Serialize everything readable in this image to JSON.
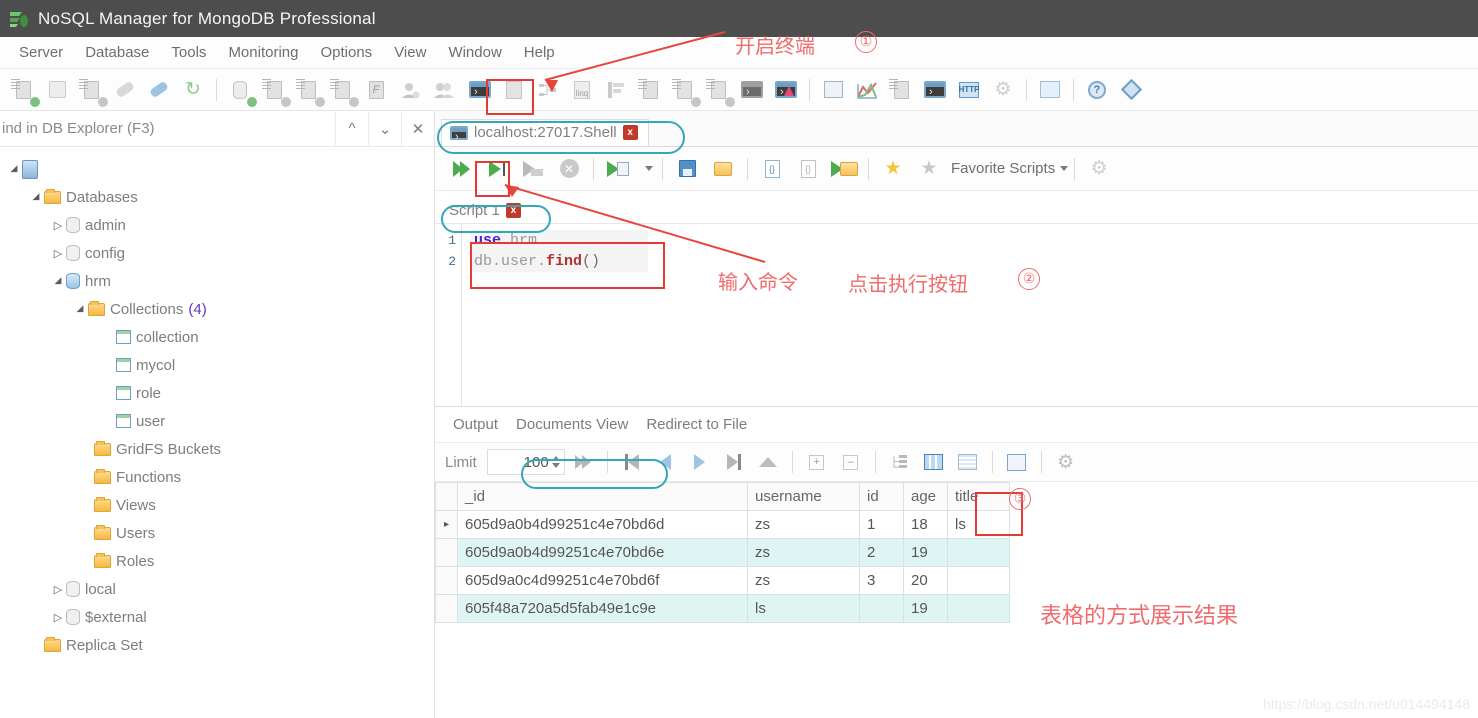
{
  "window": {
    "title": "NoSQL Manager for MongoDB Professional",
    "app_icon": "mongodb-leaf-icon"
  },
  "menubar": {
    "items": [
      "Server",
      "Database",
      "Tools",
      "Monitoring",
      "Options",
      "View",
      "Window",
      "Help"
    ]
  },
  "toolbar": {
    "buttons": [
      {
        "name": "new-connection-icon",
        "label": "New Connection"
      },
      {
        "name": "edit-connection-icon",
        "label": "Edit Connection"
      },
      {
        "name": "duplicate-connection-icon",
        "label": "Duplicate Connection"
      },
      {
        "name": "connect-icon",
        "label": "Connect"
      },
      {
        "name": "disconnect-icon",
        "label": "Disconnect"
      },
      {
        "name": "refresh-icon",
        "label": "Refresh"
      },
      {
        "name": "new-database-icon",
        "label": "New Database"
      },
      {
        "name": "new-collection-icon",
        "label": "New Collection"
      },
      {
        "name": "new-view-icon",
        "label": "New View"
      },
      {
        "name": "new-document-icon",
        "label": "New Document"
      },
      {
        "name": "new-function-icon",
        "label": "New Function"
      },
      {
        "name": "new-user-icon",
        "label": "New User"
      },
      {
        "name": "new-role-icon",
        "label": "New Role"
      },
      {
        "name": "open-shell-icon",
        "label": "Open Shell"
      },
      {
        "name": "open-document-editor-icon",
        "label": "Document Editor"
      },
      {
        "name": "aggregation-builder-icon",
        "label": "Aggregation Builder"
      },
      {
        "name": "linq-query-icon",
        "label": "LINQ Query"
      },
      {
        "name": "sql-query-icon",
        "label": "SQL Query"
      },
      {
        "name": "table-view-icon",
        "label": "Table View"
      },
      {
        "name": "import-icon",
        "label": "Import"
      },
      {
        "name": "export-icon",
        "label": "Export"
      },
      {
        "name": "backup-icon",
        "label": "Backup"
      },
      {
        "name": "restore-icon",
        "label": "Restore"
      },
      {
        "name": "options-window-icon",
        "label": "Options"
      },
      {
        "name": "chart-icon",
        "label": "Charts"
      },
      {
        "name": "copy-documents-icon",
        "label": "Copy Documents"
      },
      {
        "name": "shell-window-icon",
        "label": "Shell Window"
      },
      {
        "name": "http-icon",
        "label": "HTTP Interface"
      },
      {
        "name": "settings-gear-icon",
        "label": "Settings"
      },
      {
        "name": "home-icon",
        "label": "Home"
      },
      {
        "name": "help-icon",
        "label": "Help"
      },
      {
        "name": "about-icon",
        "label": "About"
      }
    ]
  },
  "explorer": {
    "find_label": "ind in DB Explorer (F3)",
    "find_prev_icon": "chevron-up-icon",
    "find_next_icon": "chevron-down-icon",
    "find_close_icon": "close-icon",
    "tree": [
      {
        "label": "",
        "icon": "server-icon",
        "depth": 0,
        "twisty": "open"
      },
      {
        "label": "Databases",
        "icon": "folder-icon",
        "depth": 1,
        "twisty": "open"
      },
      {
        "label": "admin",
        "icon": "database-icon",
        "depth": 2,
        "twisty": "closed"
      },
      {
        "label": "config",
        "icon": "database-icon",
        "depth": 2,
        "twisty": "closed"
      },
      {
        "label": "hrm",
        "icon": "database-active-icon",
        "depth": 2,
        "twisty": "open"
      },
      {
        "label": "Collections",
        "count": "(4)",
        "icon": "folder-icon",
        "depth": 3,
        "twisty": "open"
      },
      {
        "label": "collection",
        "icon": "collection-icon",
        "depth": 4,
        "twisty": "none"
      },
      {
        "label": "mycol",
        "icon": "collection-icon",
        "depth": 4,
        "twisty": "none"
      },
      {
        "label": "role",
        "icon": "collection-icon",
        "depth": 4,
        "twisty": "none"
      },
      {
        "label": "user",
        "icon": "collection-icon",
        "depth": 4,
        "twisty": "none"
      },
      {
        "label": "GridFS Buckets",
        "icon": "folder-icon",
        "depth": 3,
        "twisty": "none"
      },
      {
        "label": "Functions",
        "icon": "folder-icon",
        "depth": 3,
        "twisty": "none"
      },
      {
        "label": "Views",
        "icon": "folder-icon",
        "depth": 3,
        "twisty": "none"
      },
      {
        "label": "Users",
        "icon": "folder-icon",
        "depth": 3,
        "twisty": "none"
      },
      {
        "label": "Roles",
        "icon": "folder-icon",
        "depth": 3,
        "twisty": "none"
      },
      {
        "label": "local",
        "icon": "database-icon",
        "depth": 2,
        "twisty": "closed"
      },
      {
        "label": "$external",
        "icon": "database-icon",
        "depth": 2,
        "twisty": "closed"
      },
      {
        "label": "Replica Set",
        "icon": "folder-icon",
        "depth": 1,
        "twisty": "none"
      }
    ]
  },
  "shell": {
    "tab_label": "localhost:27017.Shell",
    "tab_icon": "terminal-icon",
    "tab_close": "x",
    "script_toolbar": [
      {
        "name": "execute-all-icon",
        "label": "Execute All"
      },
      {
        "name": "execute-statement-icon",
        "label": "Execute Current Statement"
      },
      {
        "name": "execute-to-file-icon",
        "label": "Execute to File"
      },
      {
        "name": "stop-icon",
        "label": "Stop"
      },
      {
        "name": "execute-options-icon",
        "label": "Execute Options"
      },
      {
        "name": "save-script-icon",
        "label": "Save Script"
      },
      {
        "name": "open-script-icon",
        "label": "Open Script"
      },
      {
        "name": "format-json-icon",
        "label": "Format"
      },
      {
        "name": "unformat-json-icon",
        "label": "Unformat"
      },
      {
        "name": "run-folder-icon",
        "label": "Run Folder"
      },
      {
        "name": "add-favorite-icon",
        "label": "Add Favorite"
      },
      {
        "name": "remove-favorite-icon",
        "label": "Remove Favorite"
      },
      {
        "name": "script-settings-icon",
        "label": "Script Settings"
      }
    ],
    "favorite_scripts_label": "Favorite Scripts",
    "script_tab_label": "Script 1",
    "script_tab_close": "x",
    "editor": {
      "line_numbers": [
        "1",
        "2"
      ],
      "lines": [
        {
          "n": "1",
          "tokens": [
            {
              "t": "use",
              "c": "kw"
            },
            {
              "t": " hrm",
              "c": "id"
            }
          ]
        },
        {
          "n": "2",
          "tokens": [
            {
              "t": "db.user.",
              "c": "id"
            },
            {
              "t": "find",
              "c": "fn"
            },
            {
              "t": "()",
              "c": "pn"
            }
          ]
        }
      ],
      "text": "use hrm\ndb.user.find()"
    }
  },
  "output": {
    "tabs": [
      "Output",
      "Documents View",
      "Redirect to File"
    ],
    "active_tab": "Documents View",
    "limit_label": "Limit",
    "limit_value": "100",
    "results_toolbar": [
      {
        "name": "fetch-all-icon",
        "label": "Fetch All"
      },
      {
        "name": "first-page-icon",
        "label": "First"
      },
      {
        "name": "prev-page-icon",
        "label": "Previous"
      },
      {
        "name": "next-page-icon",
        "label": "Next"
      },
      {
        "name": "last-page-icon",
        "label": "Last"
      },
      {
        "name": "collapse-icon",
        "label": "Collapse"
      },
      {
        "name": "expand-all-icon",
        "label": "Expand All"
      },
      {
        "name": "collapse-all-icon",
        "label": "Collapse All"
      },
      {
        "name": "tree-view-icon",
        "label": "Tree View"
      },
      {
        "name": "table-view-icon",
        "label": "Table View"
      },
      {
        "name": "text-view-icon",
        "label": "Text View"
      },
      {
        "name": "export-results-icon",
        "label": "Export Results"
      },
      {
        "name": "results-settings-icon",
        "label": "Results Settings"
      }
    ],
    "table": {
      "columns": [
        "",
        "_id",
        "username",
        "id",
        "age",
        "title"
      ],
      "rows": [
        {
          "marker": "▸",
          "_id": "605d9a0b4d99251c4e70bd6d",
          "username": "zs",
          "id": "1",
          "age": "18",
          "title": "ls"
        },
        {
          "marker": "",
          "_id": "605d9a0b4d99251c4e70bd6e",
          "username": "zs",
          "id": "2",
          "age": "19",
          "title": ""
        },
        {
          "marker": "",
          "_id": "605d9a0c4d99251c4e70bd6f",
          "username": "zs",
          "id": "3",
          "age": "20",
          "title": ""
        },
        {
          "marker": "",
          "_id": "605f48a720a5d5fab49e1c9e",
          "username": "ls",
          "id": "",
          "age": "19",
          "title": ""
        }
      ]
    }
  },
  "annotations": {
    "open_terminal": "开启终端",
    "num1": "①",
    "input_command": "输入命令",
    "click_execute": "点击执行按钮",
    "num2": "②",
    "num3": "③",
    "table_result": "表格的方式展示结果",
    "color": "#f06b6b",
    "box_color": "#e53935",
    "highlight_color": "#35a8b5"
  },
  "watermark": "https://blog.csdn.net/u014494148"
}
